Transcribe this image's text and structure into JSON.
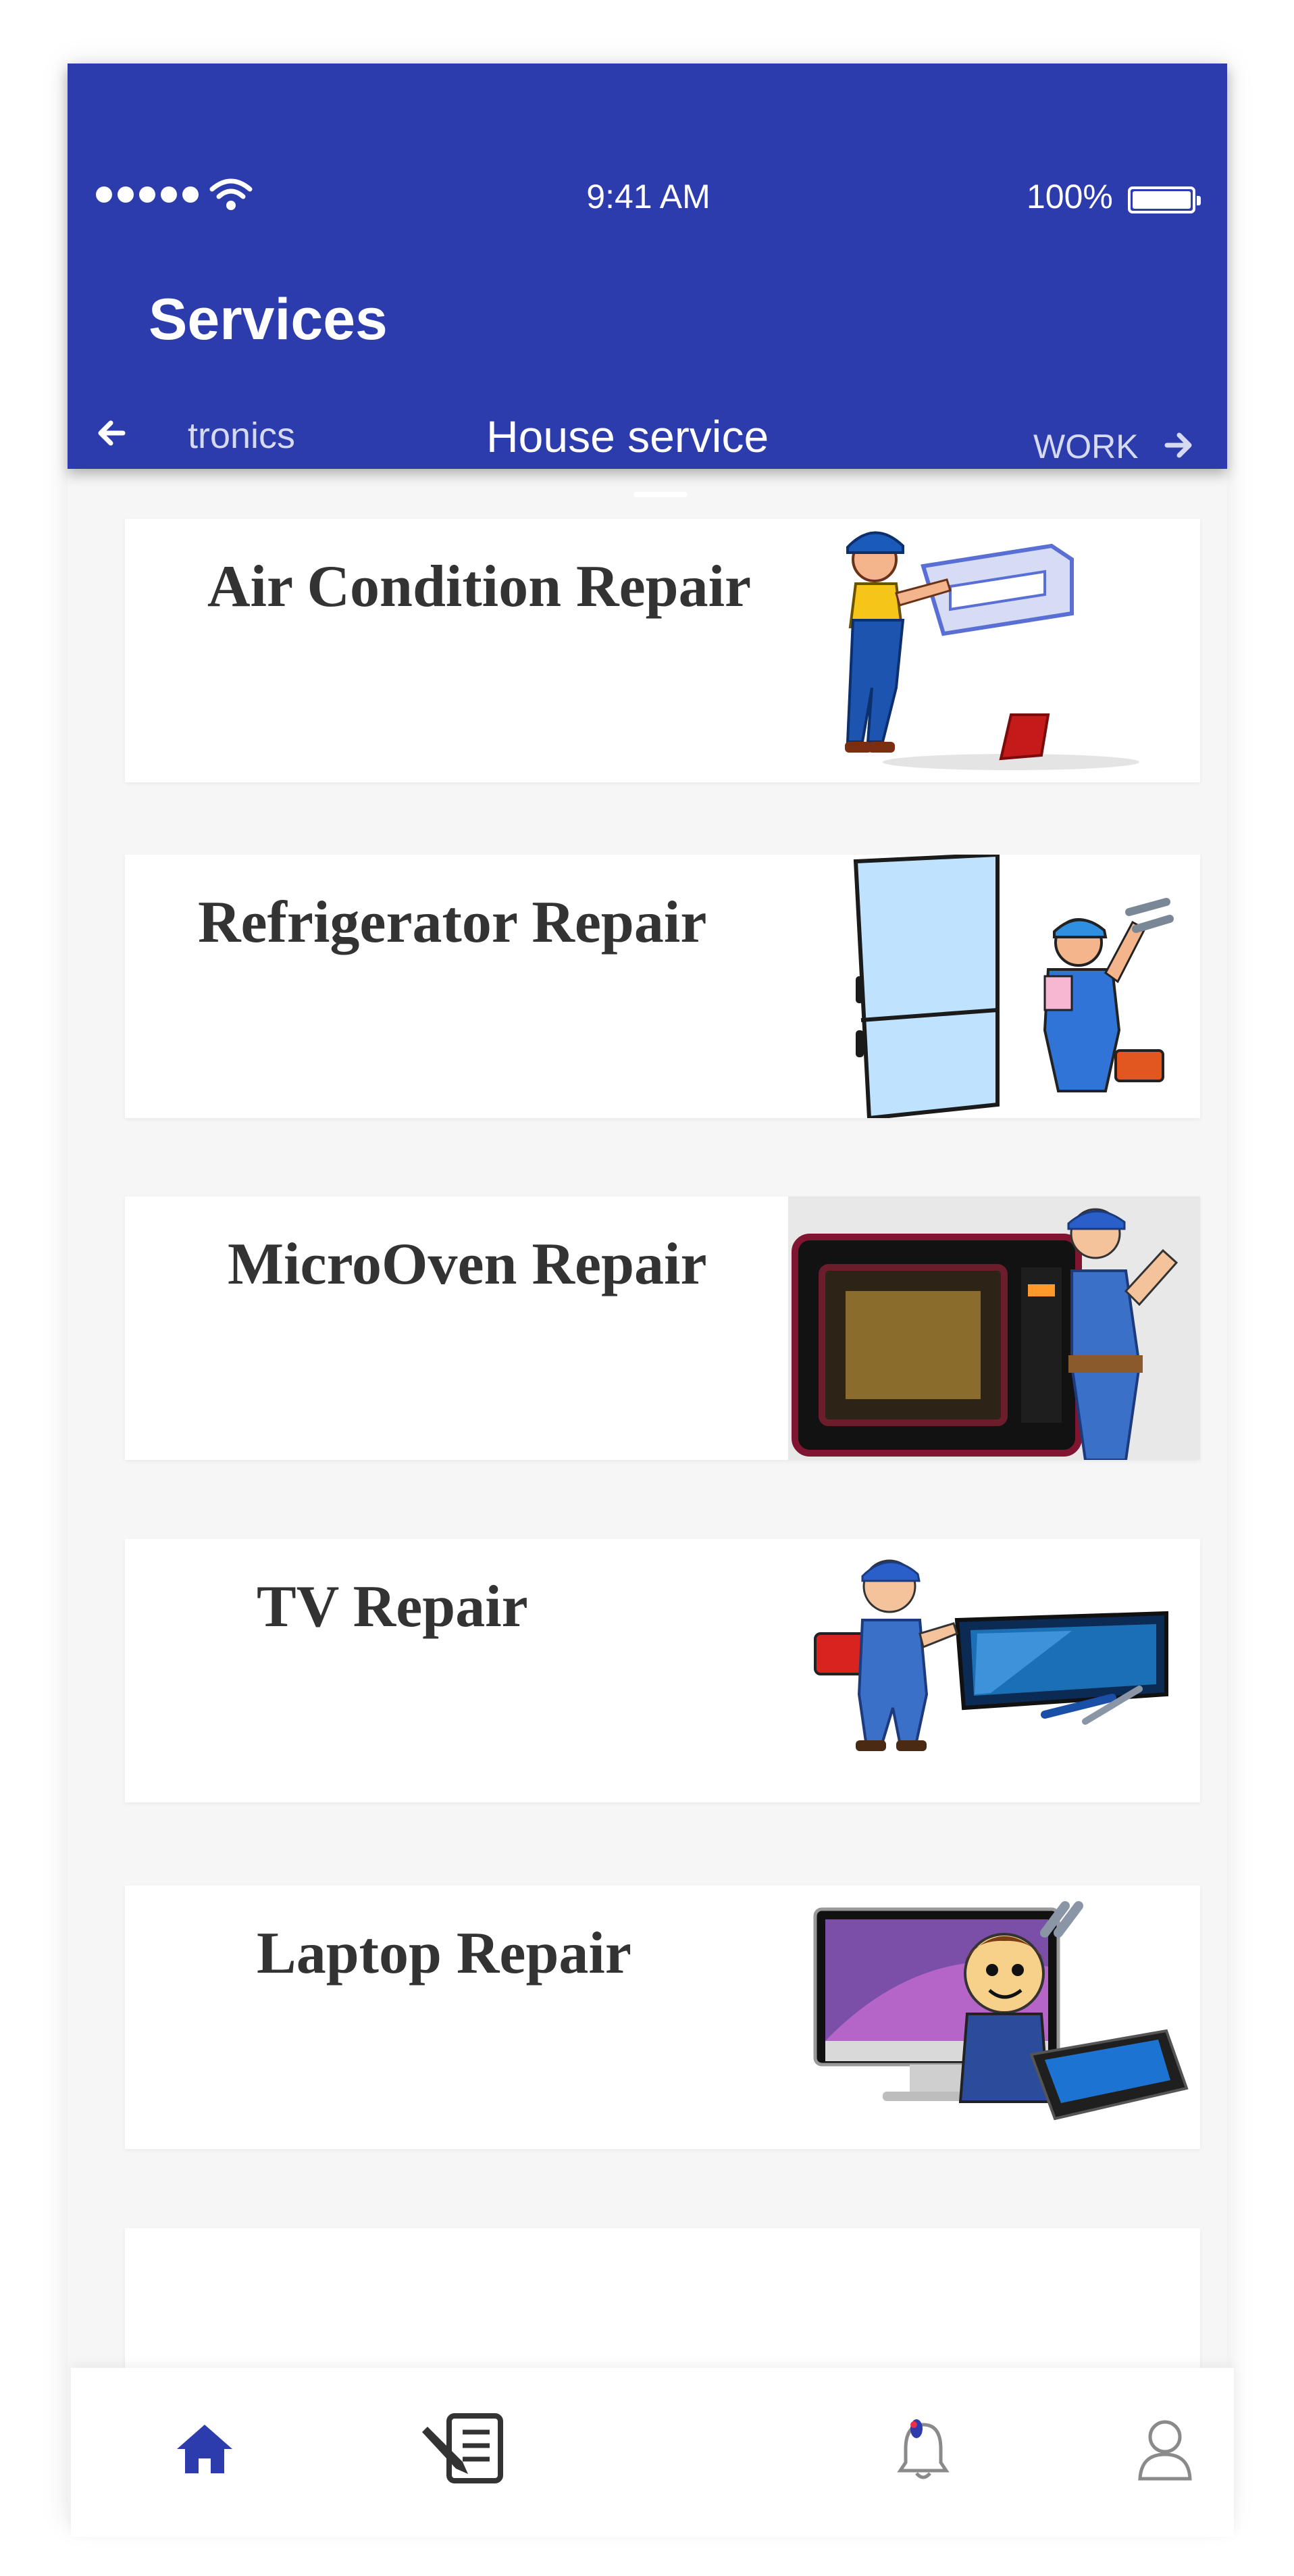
{
  "status_bar": {
    "time": "9:41 AM",
    "battery": "100%"
  },
  "header": {
    "title": "Services",
    "tabs": {
      "previous": "tronics",
      "active": "House service",
      "next": "WORK"
    }
  },
  "services": [
    {
      "title": "Air Condition Repair",
      "icon": "air-conditioner-technician"
    },
    {
      "title": "Refrigerator Repair",
      "icon": "refrigerator-technician"
    },
    {
      "title": "MicroOven Repair",
      "icon": "microwave-technician"
    },
    {
      "title": "TV Repair",
      "icon": "tv-technician"
    },
    {
      "title": "Laptop Repair",
      "icon": "laptop-technician"
    },
    {
      "title": "",
      "icon": ""
    }
  ],
  "bottom_nav": [
    {
      "icon": "home-icon",
      "active": true
    },
    {
      "icon": "edit-document-icon",
      "active": false
    },
    {
      "icon": "bell-icon",
      "active": false
    },
    {
      "icon": "profile-icon",
      "active": false
    }
  ],
  "colors": {
    "primary": "#2c3cad",
    "background": "#f6f6f6",
    "card": "#ffffff",
    "text_dark": "#333333"
  }
}
